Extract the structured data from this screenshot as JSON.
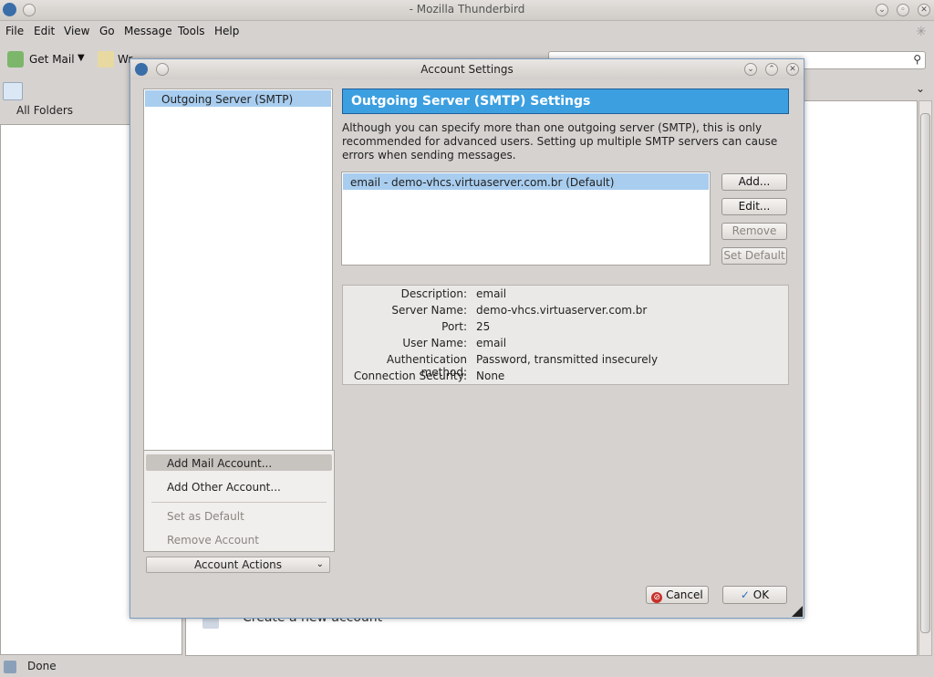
{
  "main_window": {
    "title": "- Mozilla Thunderbird",
    "menu": [
      {
        "label": "File"
      },
      {
        "label": "Edit"
      },
      {
        "label": "View"
      },
      {
        "label": "Go"
      },
      {
        "label": "Message"
      },
      {
        "label": "Tools"
      },
      {
        "label": "Help"
      }
    ],
    "toolbar": {
      "get_mail_label": "Get Mail",
      "write_label": "Wr"
    },
    "folder_pane": {
      "all_folders_label": "All Folders"
    },
    "status": {
      "text": "Done"
    },
    "create_account_label": "Create a new account"
  },
  "dialog": {
    "title": "Account Settings",
    "account_tree": {
      "selected_item": "Outgoing Server (SMTP)"
    },
    "context_menu": {
      "add_mail_account": "Add Mail Account...",
      "add_other_account": "Add Other Account...",
      "set_as_default": "Set as Default",
      "remove_account": "Remove Account"
    },
    "account_actions_label": "Account Actions",
    "settings": {
      "header": "Outgoing Server (SMTP) Settings",
      "description": "Although you can specify more than one outgoing server (SMTP), this is only recommended for advanced users. Setting up multiple SMTP servers can cause errors when sending messages.",
      "server_list": [
        "email - demo-vhcs.virtuaserver.com.br (Default)"
      ],
      "buttons": {
        "add": "Add...",
        "edit": "Edit...",
        "remove": "Remove",
        "set_default": "Set Default"
      },
      "details": {
        "description_label": "Description:",
        "description_value": "email",
        "server_name_label": "Server Name:",
        "server_name_value": "demo-vhcs.virtuaserver.com.br",
        "port_label": "Port:",
        "port_value": "25",
        "user_name_label": "User Name:",
        "user_name_value": "email",
        "auth_label": "Authentication method:",
        "auth_value": "Password, transmitted insecurely",
        "security_label": "Connection Security:",
        "security_value": "None"
      }
    },
    "footer": {
      "cancel": "Cancel",
      "ok": "OK"
    }
  }
}
